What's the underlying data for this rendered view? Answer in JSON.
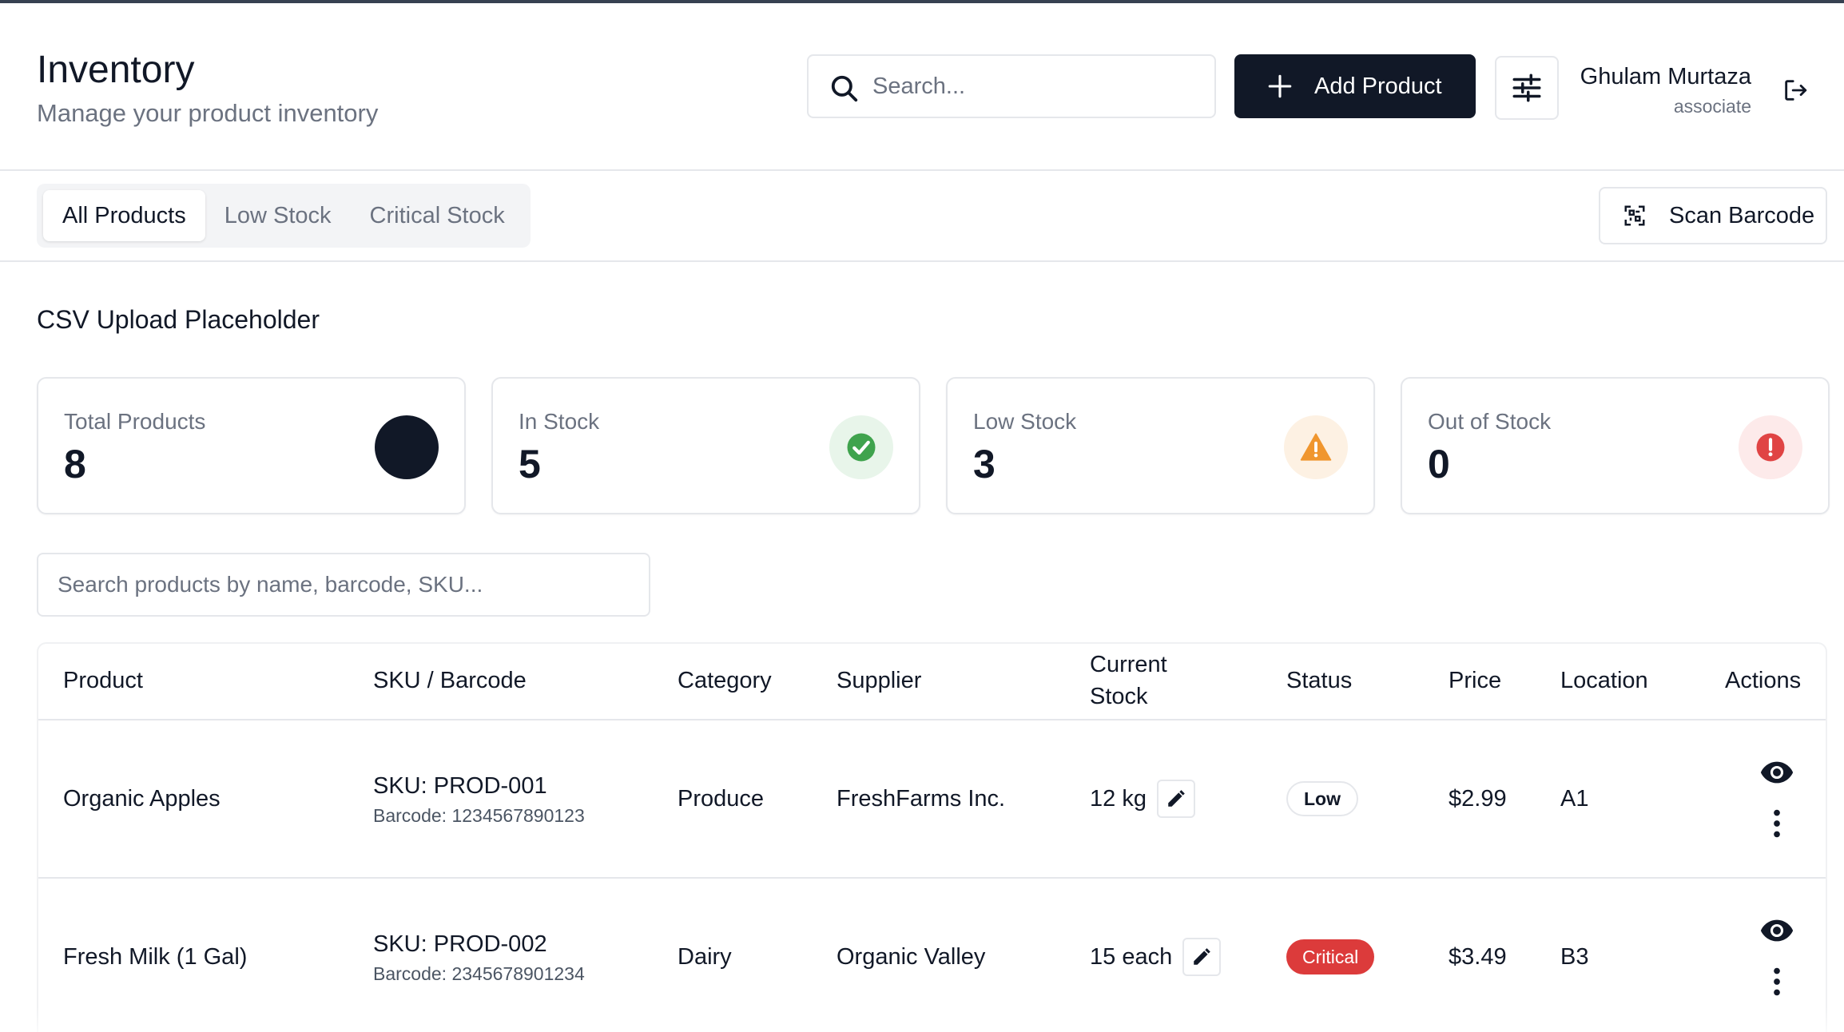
{
  "header": {
    "title": "Inventory",
    "subtitle": "Manage your product inventory",
    "search_placeholder": "Search...",
    "add_button_label": "Add Product",
    "user_name": "Ghulam Murtaza",
    "user_role": "associate"
  },
  "tabs": [
    {
      "label": "All Products",
      "active": true
    },
    {
      "label": "Low Stock",
      "active": false
    },
    {
      "label": "Critical Stock",
      "active": false
    }
  ],
  "scan_button_label": "Scan Barcode",
  "csv_placeholder": "CSV Upload Placeholder",
  "stats": [
    {
      "label": "Total Products",
      "value": "8",
      "icon": "dark-circle-icon"
    },
    {
      "label": "In Stock",
      "value": "5",
      "icon": "check-circle-icon",
      "color": "#3fa34d"
    },
    {
      "label": "Low Stock",
      "value": "3",
      "icon": "warning-triangle-icon",
      "color": "#f0962e"
    },
    {
      "label": "Out of Stock",
      "value": "0",
      "icon": "alert-circle-icon",
      "color": "#e04444"
    }
  ],
  "filter_placeholder": "Search products by name, barcode, SKU...",
  "table": {
    "columns": [
      "Product",
      "SKU / Barcode",
      "Category",
      "Supplier",
      "Current",
      "Stock",
      "Status",
      "Price",
      "Location",
      "Actions"
    ],
    "rows": [
      {
        "product": "Organic Apples",
        "sku": "SKU: PROD-001",
        "barcode": "Barcode: 1234567890123",
        "category": "Produce",
        "supplier": "FreshFarms Inc.",
        "stock": "12 kg",
        "status": "Low",
        "price": "$2.99",
        "location": "A1"
      },
      {
        "product": "Fresh Milk (1 Gal)",
        "sku": "SKU: PROD-002",
        "barcode": "Barcode: 2345678901234",
        "category": "Dairy",
        "supplier": "Organic Valley",
        "stock": "15 each",
        "status": "Critical",
        "price": "$3.49",
        "location": "B3"
      }
    ]
  },
  "colors": {
    "primary": "#111827",
    "critical": "#dc3b3b",
    "success": "#3fa34d",
    "warning": "#f0962e"
  }
}
